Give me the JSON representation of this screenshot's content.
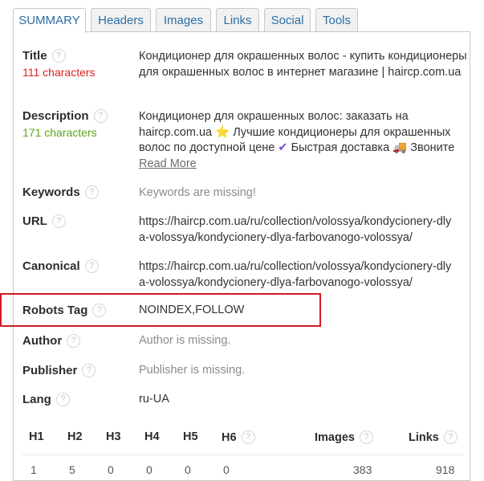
{
  "tabs": [
    {
      "label": "SUMMARY"
    },
    {
      "label": "Headers"
    },
    {
      "label": "Images"
    },
    {
      "label": "Links"
    },
    {
      "label": "Social"
    },
    {
      "label": "Tools"
    }
  ],
  "help_glyph": "?",
  "title": {
    "label": "Title",
    "count": "111 characters",
    "value": "Кондиционер для окрашенных волос - купить кондиционеры для окрашенных волос в интернет магазине | haircp.com.ua"
  },
  "description": {
    "label": "Description",
    "count": "171 characters",
    "value_part1": "Кондиционер для окрашенных волос: заказать на haircp.com.ua",
    "value_part2": "Лучшие кондиционеры для окрашенных волос по доступной цене",
    "value_part3": "Быстрая доставка",
    "value_part4": "Звоните",
    "emoji_star": "⭐",
    "emoji_check": "✔",
    "emoji_truck": "🚚",
    "read_more": "Read More"
  },
  "keywords": {
    "label": "Keywords",
    "value": "Keywords are missing!"
  },
  "url": {
    "label": "URL",
    "value": "https://haircp.com.ua/ru/collection/volossya/kondycionery-dlya-volossya/kondycionery-dlya-farbovanogo-volossya/"
  },
  "canonical": {
    "label": "Canonical",
    "value": "https://haircp.com.ua/ru/collection/volossya/kondycionery-dlya-volossya/kondycionery-dlya-farbovanogo-volossya/"
  },
  "robots": {
    "label": "Robots Tag",
    "value": "NOINDEX,FOLLOW"
  },
  "author": {
    "label": "Author",
    "value": "Author is missing."
  },
  "publisher": {
    "label": "Publisher",
    "value": "Publisher is missing."
  },
  "lang": {
    "label": "Lang",
    "value": "ru-UA"
  },
  "headings": {
    "h1": "H1",
    "h2": "H2",
    "h3": "H3",
    "h4": "H4",
    "h5": "H5",
    "h6": "H6",
    "images": "Images",
    "links": "Links"
  },
  "counts": {
    "h1": "1",
    "h2": "5",
    "h3": "0",
    "h4": "0",
    "h5": "0",
    "h6": "0",
    "images": "383",
    "links": "918"
  },
  "colors": {
    "highlight": "#cf1b23",
    "tab_text": "#2c6ea3",
    "bad": "#e02020",
    "good": "#5aa51a"
  }
}
